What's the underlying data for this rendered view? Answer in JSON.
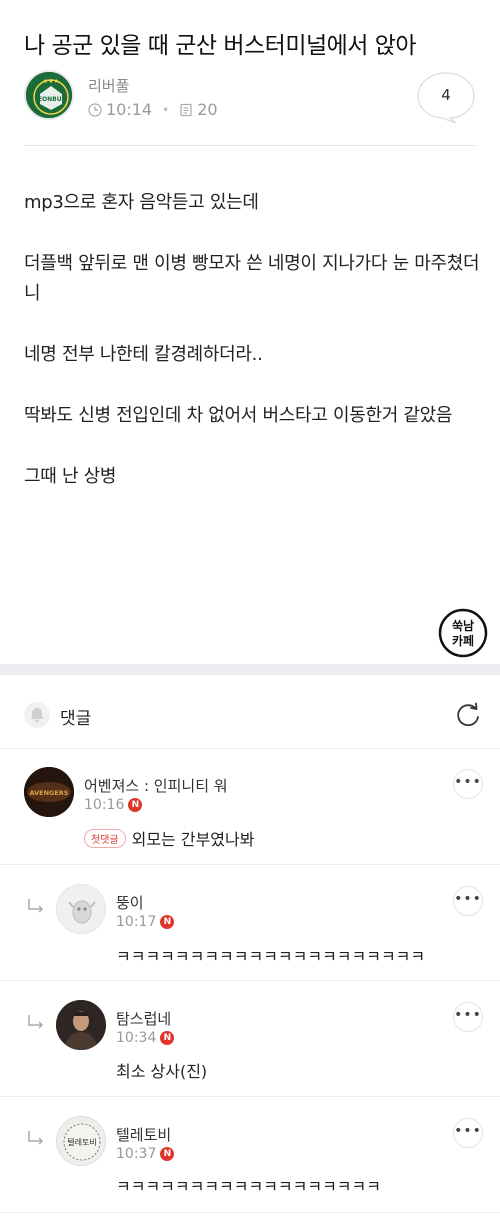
{
  "post": {
    "title": "나 공군 있을 때 군산 버스터미널에서 앉아",
    "author": "리버풀",
    "time": "10:14",
    "views": "20",
    "comment_count": "4",
    "paragraphs": [
      "mp3으로 혼자 음악듣고 있는데",
      "더플백 앞뒤로 맨 이병 빵모자 쓴 네명이 지나가다 눈 마주쳤더니",
      "네명 전부 나한테 칼경례하더라..",
      "딱봐도 신병 전입인데 차 없어서 버스타고 이동한거 같았음",
      "그때 난 상병"
    ],
    "avatar_text": "JEONBUK",
    "stamp_text": [
      "쑥남",
      "카페"
    ]
  },
  "comments_section": {
    "title": "댓글"
  },
  "comments": [
    {
      "author": "어벤져스 : 인피니티 워",
      "time": "10:16",
      "badge": "첫댓글",
      "text": "외모는 간부였나봐",
      "new_mark": "N",
      "avatar_label": "AVENGERS"
    },
    {
      "author": "뚱이",
      "time": "10:17",
      "text": "ㅋㅋㅋㅋㅋㅋㅋㅋㅋㅋㅋㅋㅋㅋㅋㅋㅋㅋㅋㅋㅋ",
      "new_mark": "N"
    },
    {
      "author": "탐스럽네",
      "time": "10:34",
      "text": "최소 상사(진)",
      "new_mark": "N"
    },
    {
      "author": "텔레토비",
      "time": "10:37",
      "text": "ㅋㅋㅋㅋㅋㅋㅋㅋㅋㅋㅋㅋㅋㅋㅋㅋㅋㅋ",
      "new_mark": "N",
      "avatar_label": "텔레토비"
    }
  ],
  "more_label": "•••"
}
